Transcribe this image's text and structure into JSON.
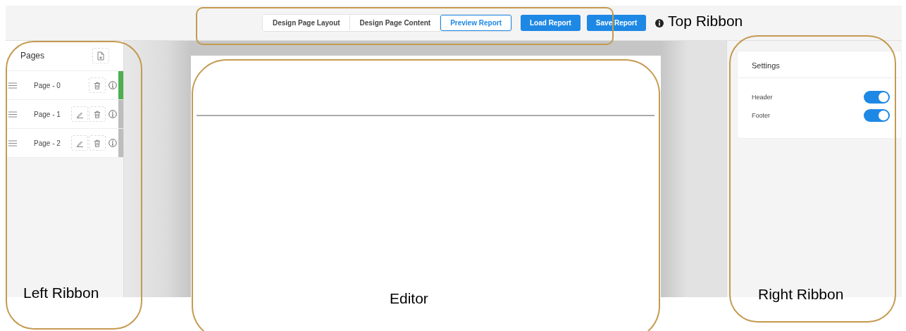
{
  "top_ribbon": {
    "tabs": [
      {
        "label": "Design Page Layout",
        "selected": false
      },
      {
        "label": "Design Page Content",
        "selected": false
      },
      {
        "label": "Preview Report",
        "selected": true
      }
    ],
    "buttons": [
      "Load Report",
      "Save Report"
    ]
  },
  "pages_panel": {
    "title": "Pages",
    "pages": [
      {
        "label": "Page - 0",
        "editable": false,
        "selected": true
      },
      {
        "label": "Page - 1",
        "editable": true,
        "selected": false
      },
      {
        "label": "Page - 2",
        "editable": true,
        "selected": false
      }
    ]
  },
  "settings": {
    "title": "Settings",
    "toggles": [
      {
        "label": "Header",
        "on": true
      },
      {
        "label": "Footer",
        "on": true
      }
    ]
  },
  "annotations": [
    {
      "label": "Top Ribbon"
    },
    {
      "label": "Left Ribbon"
    },
    {
      "label": "Editor"
    },
    {
      "label": "Right Ribbon"
    }
  ]
}
